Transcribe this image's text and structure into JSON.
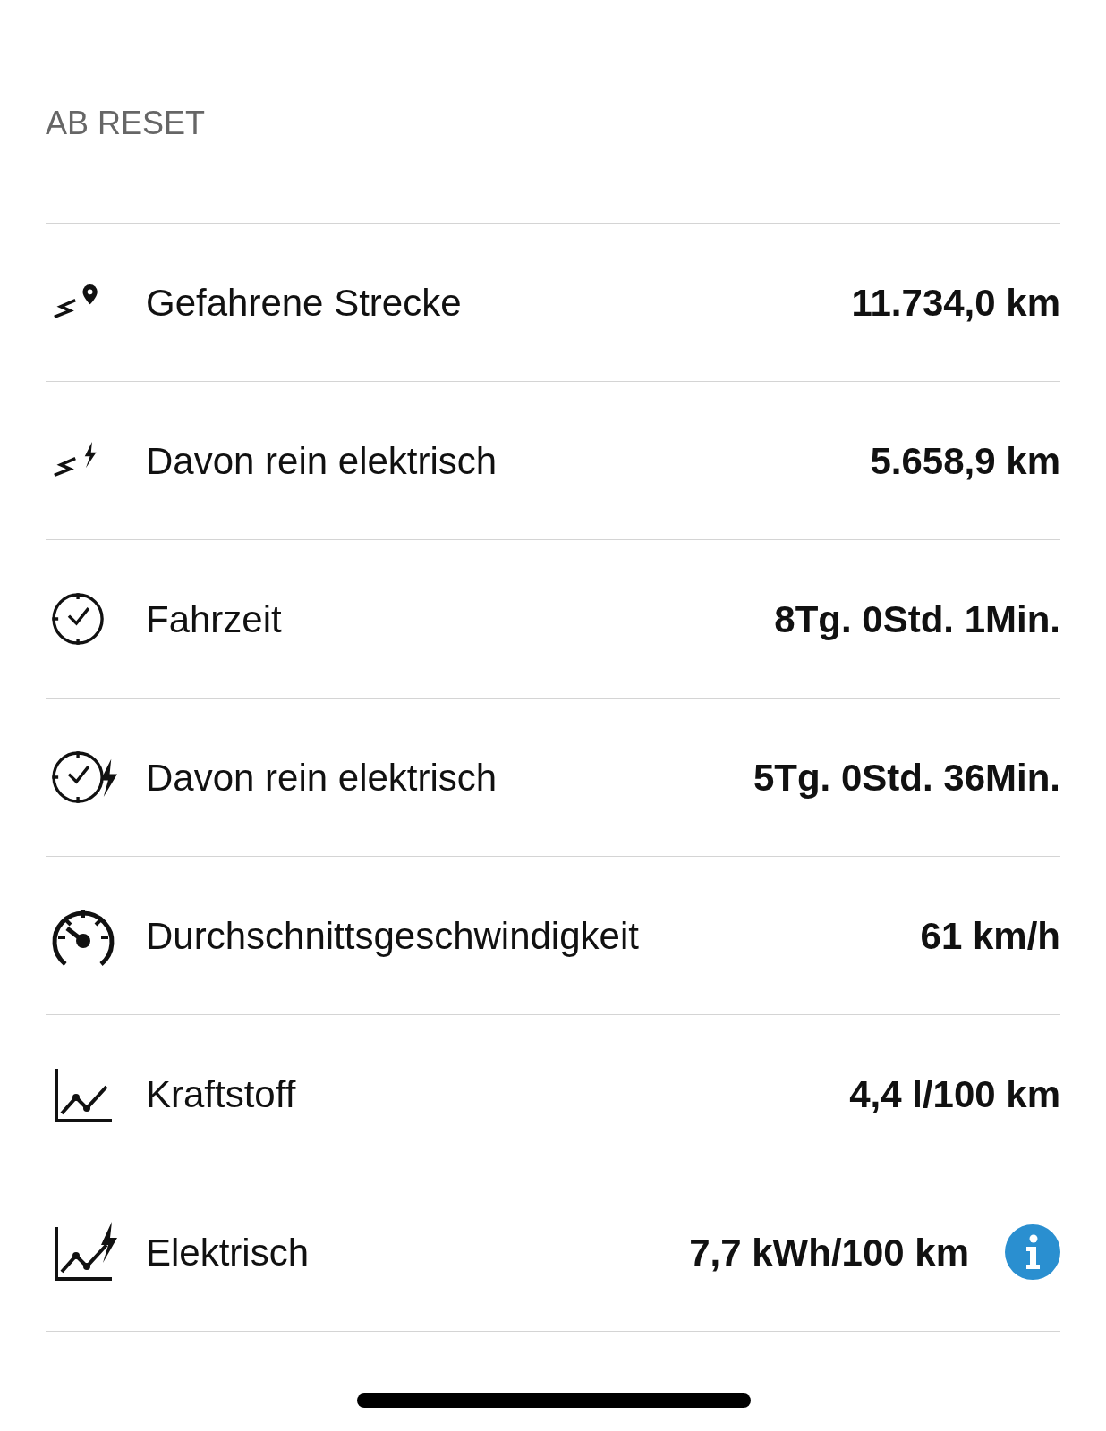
{
  "section_title": "AB RESET",
  "rows": [
    {
      "kind": "distance",
      "label": "Gefahrene Strecke",
      "value": "11.734,0 km",
      "info_button": false
    },
    {
      "kind": "distance-electric",
      "label": "Davon rein elektrisch",
      "value": "5.658,9 km",
      "info_button": false
    },
    {
      "kind": "time",
      "label": "Fahrzeit",
      "value": "8Tg. 0Std. 1Min.",
      "info_button": false
    },
    {
      "kind": "time-electric",
      "label": "Davon rein elektrisch",
      "value": "5Tg. 0Std. 36Min.",
      "info_button": false
    },
    {
      "kind": "speed",
      "label": "Durchschnittsgeschwindigkeit",
      "value": "61 km/h",
      "info_button": false
    },
    {
      "kind": "consumption",
      "label": "Kraftstoff",
      "value": "4,4 l/100 km",
      "info_button": false
    },
    {
      "kind": "consumption-electric",
      "label": "Elektrisch",
      "value": "7,7 kWh/100 km",
      "info_button": true
    }
  ]
}
